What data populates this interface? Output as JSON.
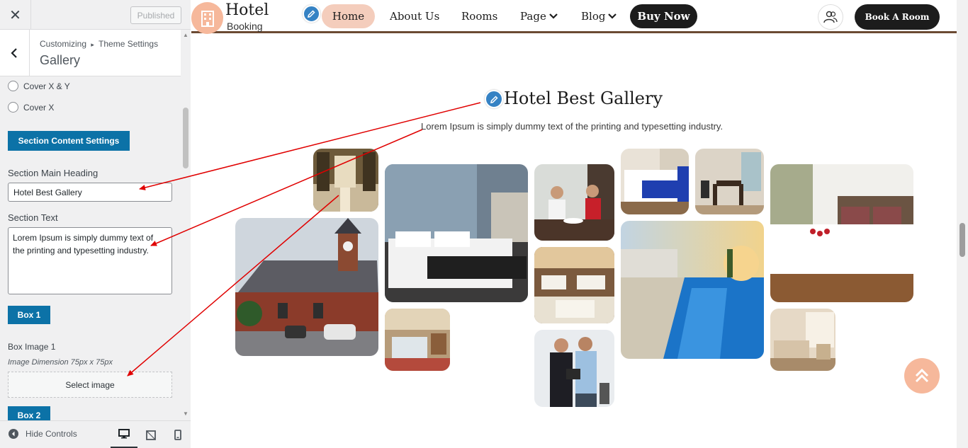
{
  "customizer": {
    "close_glyph": "✕",
    "published_label": "Published",
    "breadcrumb_root": "Customizing",
    "breadcrumb_sep": "▸",
    "breadcrumb_parent": "Theme Settings",
    "section_title": "Gallery",
    "radio_options": [
      "Cover X & Y",
      "Cover X"
    ],
    "section_content_button": "Section Content Settings",
    "main_heading_label": "Section Main Heading",
    "main_heading_value": "Hotel Best Gallery",
    "section_text_label": "Section Text",
    "section_text_value": "Lorem Ipsum is simply dummy text of the printing and typesetting industry.",
    "box1_button": "Box 1",
    "box_image_label": "Box Image 1",
    "image_dimension_note": "Image Dimension 75px x 75px",
    "select_image_button": "Select image",
    "box2_button": "Box 2",
    "hide_controls_label": "Hide Controls"
  },
  "site": {
    "logo_title": "Hotel",
    "logo_subtitle": "Booking",
    "nav": [
      "Home",
      "About Us",
      "Rooms",
      "Page",
      "Blog",
      "Buy Now"
    ],
    "book_button": "Book A Room",
    "accent_color": "#f6b89b",
    "dark_color": "#1c1c1c",
    "header_border_color": "#6b4a33"
  },
  "gallery": {
    "heading": "Hotel Best Gallery",
    "text": "Lorem Ipsum is simply dummy text of the printing and typesetting industry.",
    "images": [
      "lobby",
      "historic-building",
      "bedroom-modern",
      "suite-small",
      "dining-couple",
      "restaurant",
      "staff-meeting",
      "bedroom-blue",
      "dining-room",
      "pool-resort",
      "bedroom-roses",
      "bedroom-beige"
    ]
  }
}
